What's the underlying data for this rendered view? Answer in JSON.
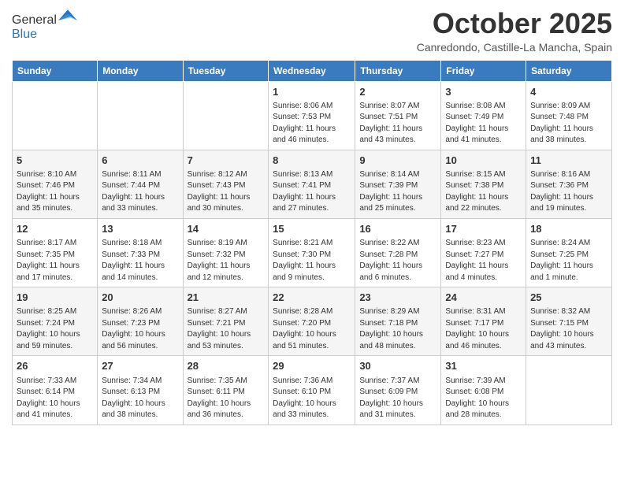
{
  "logo": {
    "general": "General",
    "blue": "Blue"
  },
  "header": {
    "month": "October 2025",
    "location": "Canredondo, Castille-La Mancha, Spain"
  },
  "weekdays": [
    "Sunday",
    "Monday",
    "Tuesday",
    "Wednesday",
    "Thursday",
    "Friday",
    "Saturday"
  ],
  "weeks": [
    [
      {
        "day": "",
        "info": ""
      },
      {
        "day": "",
        "info": ""
      },
      {
        "day": "",
        "info": ""
      },
      {
        "day": "1",
        "info": "Sunrise: 8:06 AM\nSunset: 7:53 PM\nDaylight: 11 hours and 46 minutes."
      },
      {
        "day": "2",
        "info": "Sunrise: 8:07 AM\nSunset: 7:51 PM\nDaylight: 11 hours and 43 minutes."
      },
      {
        "day": "3",
        "info": "Sunrise: 8:08 AM\nSunset: 7:49 PM\nDaylight: 11 hours and 41 minutes."
      },
      {
        "day": "4",
        "info": "Sunrise: 8:09 AM\nSunset: 7:48 PM\nDaylight: 11 hours and 38 minutes."
      }
    ],
    [
      {
        "day": "5",
        "info": "Sunrise: 8:10 AM\nSunset: 7:46 PM\nDaylight: 11 hours and 35 minutes."
      },
      {
        "day": "6",
        "info": "Sunrise: 8:11 AM\nSunset: 7:44 PM\nDaylight: 11 hours and 33 minutes."
      },
      {
        "day": "7",
        "info": "Sunrise: 8:12 AM\nSunset: 7:43 PM\nDaylight: 11 hours and 30 minutes."
      },
      {
        "day": "8",
        "info": "Sunrise: 8:13 AM\nSunset: 7:41 PM\nDaylight: 11 hours and 27 minutes."
      },
      {
        "day": "9",
        "info": "Sunrise: 8:14 AM\nSunset: 7:39 PM\nDaylight: 11 hours and 25 minutes."
      },
      {
        "day": "10",
        "info": "Sunrise: 8:15 AM\nSunset: 7:38 PM\nDaylight: 11 hours and 22 minutes."
      },
      {
        "day": "11",
        "info": "Sunrise: 8:16 AM\nSunset: 7:36 PM\nDaylight: 11 hours and 19 minutes."
      }
    ],
    [
      {
        "day": "12",
        "info": "Sunrise: 8:17 AM\nSunset: 7:35 PM\nDaylight: 11 hours and 17 minutes."
      },
      {
        "day": "13",
        "info": "Sunrise: 8:18 AM\nSunset: 7:33 PM\nDaylight: 11 hours and 14 minutes."
      },
      {
        "day": "14",
        "info": "Sunrise: 8:19 AM\nSunset: 7:32 PM\nDaylight: 11 hours and 12 minutes."
      },
      {
        "day": "15",
        "info": "Sunrise: 8:21 AM\nSunset: 7:30 PM\nDaylight: 11 hours and 9 minutes."
      },
      {
        "day": "16",
        "info": "Sunrise: 8:22 AM\nSunset: 7:28 PM\nDaylight: 11 hours and 6 minutes."
      },
      {
        "day": "17",
        "info": "Sunrise: 8:23 AM\nSunset: 7:27 PM\nDaylight: 11 hours and 4 minutes."
      },
      {
        "day": "18",
        "info": "Sunrise: 8:24 AM\nSunset: 7:25 PM\nDaylight: 11 hours and 1 minute."
      }
    ],
    [
      {
        "day": "19",
        "info": "Sunrise: 8:25 AM\nSunset: 7:24 PM\nDaylight: 10 hours and 59 minutes."
      },
      {
        "day": "20",
        "info": "Sunrise: 8:26 AM\nSunset: 7:23 PM\nDaylight: 10 hours and 56 minutes."
      },
      {
        "day": "21",
        "info": "Sunrise: 8:27 AM\nSunset: 7:21 PM\nDaylight: 10 hours and 53 minutes."
      },
      {
        "day": "22",
        "info": "Sunrise: 8:28 AM\nSunset: 7:20 PM\nDaylight: 10 hours and 51 minutes."
      },
      {
        "day": "23",
        "info": "Sunrise: 8:29 AM\nSunset: 7:18 PM\nDaylight: 10 hours and 48 minutes."
      },
      {
        "day": "24",
        "info": "Sunrise: 8:31 AM\nSunset: 7:17 PM\nDaylight: 10 hours and 46 minutes."
      },
      {
        "day": "25",
        "info": "Sunrise: 8:32 AM\nSunset: 7:15 PM\nDaylight: 10 hours and 43 minutes."
      }
    ],
    [
      {
        "day": "26",
        "info": "Sunrise: 7:33 AM\nSunset: 6:14 PM\nDaylight: 10 hours and 41 minutes."
      },
      {
        "day": "27",
        "info": "Sunrise: 7:34 AM\nSunset: 6:13 PM\nDaylight: 10 hours and 38 minutes."
      },
      {
        "day": "28",
        "info": "Sunrise: 7:35 AM\nSunset: 6:11 PM\nDaylight: 10 hours and 36 minutes."
      },
      {
        "day": "29",
        "info": "Sunrise: 7:36 AM\nSunset: 6:10 PM\nDaylight: 10 hours and 33 minutes."
      },
      {
        "day": "30",
        "info": "Sunrise: 7:37 AM\nSunset: 6:09 PM\nDaylight: 10 hours and 31 minutes."
      },
      {
        "day": "31",
        "info": "Sunrise: 7:39 AM\nSunset: 6:08 PM\nDaylight: 10 hours and 28 minutes."
      },
      {
        "day": "",
        "info": ""
      }
    ]
  ]
}
